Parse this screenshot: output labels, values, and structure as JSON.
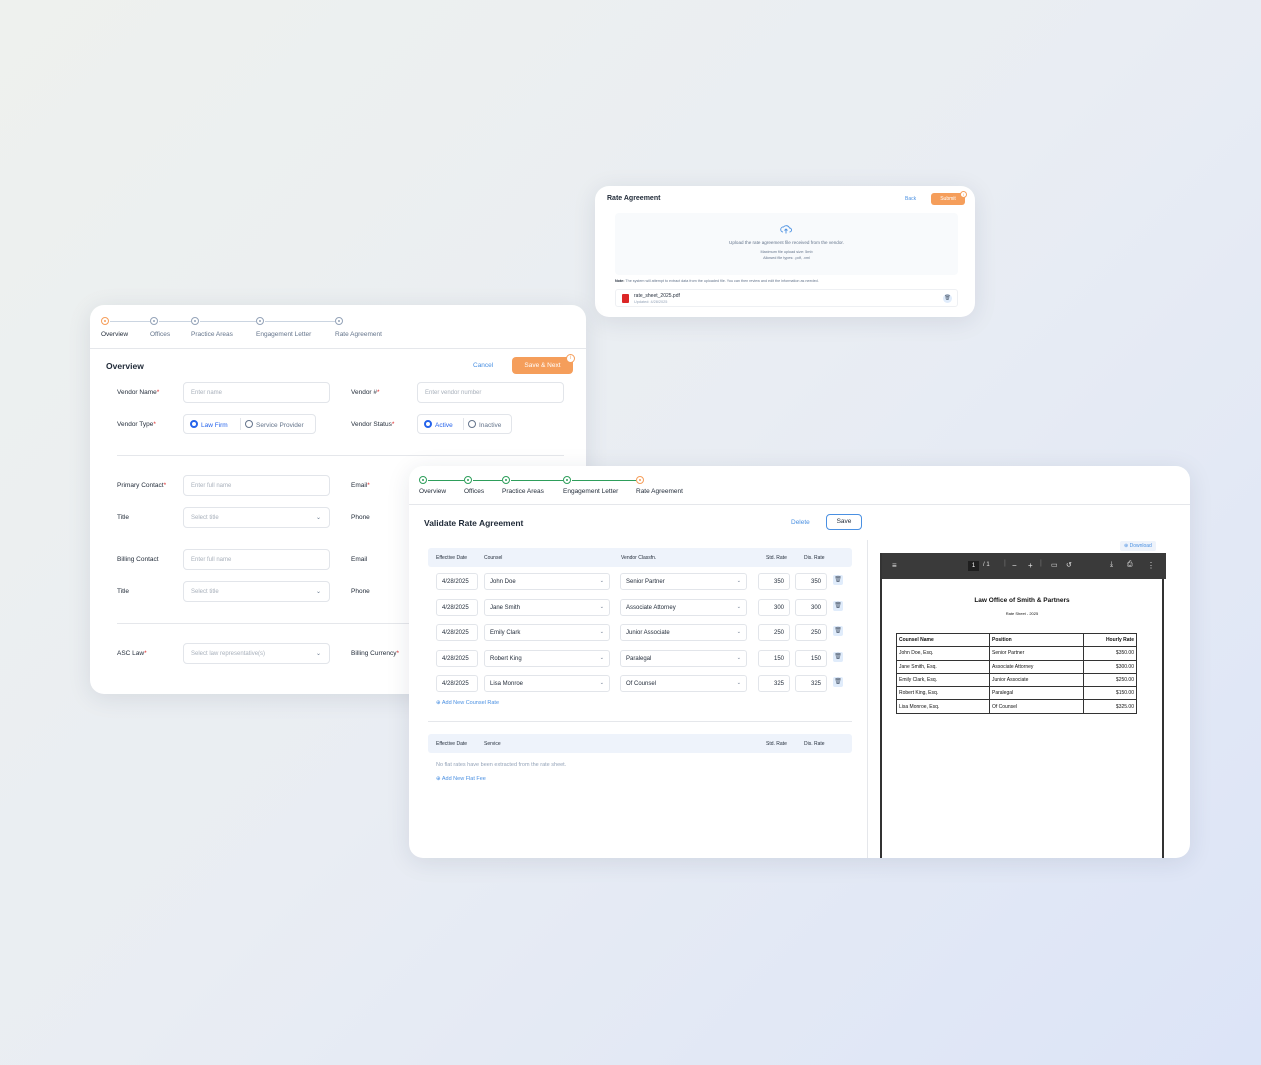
{
  "upload": {
    "title": "Rate Agreement",
    "back": "Back",
    "submit": "Submit",
    "drop_text": "Upload the rate agreement file received from the vendor.",
    "max_size": "Maximum file upload size: 5mb",
    "allowed": "Allowed file types: .pdf, .xml",
    "note_label": "Note:",
    "note_text": " The system will attempt to extract data from the uploaded file. You can then review and edit the information as needed.",
    "file_name": "rate_sheet_2025.pdf",
    "file_updated": "Updated: 4/28/2025"
  },
  "overview": {
    "steps": [
      "Overview",
      "Offices",
      "Practice Areas",
      "Engagement Letter",
      "Rate Agreement"
    ],
    "title": "Overview",
    "cancel": "Cancel",
    "save_next": "Save & Next",
    "vendor_name_label": "Vendor Name",
    "vendor_name_ph": "Enter name",
    "vendor_num_label": "Vendor #",
    "vendor_num_ph": "Enter vendor number",
    "vendor_type_label": "Vendor Type",
    "vendor_type_opts": [
      "Law Firm",
      "Service Provider"
    ],
    "vendor_status_label": "Vendor Status",
    "vendor_status_opts": [
      "Active",
      "Inactive"
    ],
    "primary_contact_label": "Primary Contact",
    "primary_contact_ph": "Enter full name",
    "email_label": "Email",
    "title_label": "Title",
    "title_ph": "Select title",
    "phone_label": "Phone",
    "billing_contact_label": "Billing Contact",
    "billing_contact_ph": "Enter full name",
    "billing_email_label": "Email",
    "billing_title_label": "Title",
    "billing_title_ph": "Select title",
    "billing_phone_label": "Phone",
    "asc_law_label": "ASC Law",
    "asc_law_ph": "Select law representative(s)",
    "billing_currency_label": "Billing Currency"
  },
  "validate": {
    "steps": [
      "Overview",
      "Offices",
      "Practice Areas",
      "Engagement Letter",
      "Rate Agreement"
    ],
    "title": "Validate Rate Agreement",
    "delete": "Delete",
    "save": "Save",
    "counsel_headers": [
      "Effective Date",
      "Counsel",
      "Vendor Classfn.",
      "Std. Rate",
      "Dis. Rate"
    ],
    "counsel_rows": [
      {
        "date": "4/28/2025",
        "counsel": "John Doe",
        "classfn": "Senior Partner",
        "std": "350",
        "dis": "350"
      },
      {
        "date": "4/28/2025",
        "counsel": "Jane Smith",
        "classfn": "Associate Attorney",
        "std": "300",
        "dis": "300"
      },
      {
        "date": "4/28/2025",
        "counsel": "Emily Clark",
        "classfn": "Junior Associate",
        "std": "250",
        "dis": "250"
      },
      {
        "date": "4/28/2025",
        "counsel": "Robert King",
        "classfn": "Paralegal",
        "std": "150",
        "dis": "150"
      },
      {
        "date": "4/28/2025",
        "counsel": "Lisa Monroe",
        "classfn": "Of Counsel",
        "std": "325",
        "dis": "325"
      }
    ],
    "add_counsel": "Add New Counsel Rate",
    "flat_headers": [
      "Effective Date",
      "Service",
      "Std. Rate",
      "Dis. Rate"
    ],
    "flat_empty": "No flat rates have been extracted from the rate sheet.",
    "add_flat": "Add New Flat Fee",
    "download": "Download"
  },
  "pdf": {
    "page": "1",
    "page_of": "/  1",
    "doc_title": "Law Office of Smith & Partners",
    "doc_sub": "Rate Sheet - 2025",
    "headers": [
      "Counsel Name",
      "Position",
      "Hourly Rate"
    ],
    "rows": [
      [
        "John Doe, Esq.",
        "Senior Partner",
        "$350.00"
      ],
      [
        "Jane Smith, Esq.",
        "Associate Attorney",
        "$300.00"
      ],
      [
        "Emily Clark, Esq.",
        "Junior Associate",
        "$250.00"
      ],
      [
        "Robert King, Esq.",
        "Paralegal",
        "$150.00"
      ],
      [
        "Lisa Monroe, Esq.",
        "Of Counsel",
        "$325.00"
      ]
    ]
  },
  "colors": {
    "accent": "#f59e5b",
    "link": "#4a90e2",
    "complete": "#2e9e5b",
    "radio": "#2563eb"
  },
  "icons": [
    "upload-cloud-icon",
    "pdf-file-icon",
    "trash-icon",
    "info-icon",
    "chevron-down-icon",
    "plus-circle-icon",
    "menu-icon",
    "zoom-out-icon",
    "zoom-in-icon",
    "fit-page-icon",
    "rotate-icon",
    "download-icon",
    "print-icon",
    "more-icon"
  ]
}
